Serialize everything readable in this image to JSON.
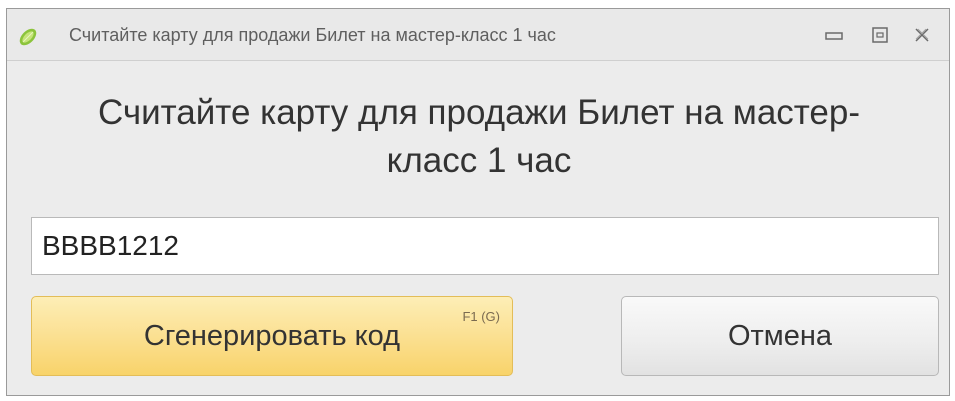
{
  "window": {
    "title": "Считайте карту для продажи Билет на мастер-класс 1 час",
    "icon": "lime-slice-icon"
  },
  "titlebar_buttons": {
    "minimize": "minimize-icon",
    "maximize": "maximize-icon",
    "close": "close-icon"
  },
  "prompt": {
    "line1": "Считайте карту для продажи Билет на мастер-",
    "line2": "класс 1 час"
  },
  "card_input": {
    "value": "BBBB1212",
    "placeholder": ""
  },
  "buttons": {
    "generate_label": "Сгенерировать код",
    "generate_hotkey": "F1 (G)",
    "cancel_label": "Отмена"
  },
  "colors": {
    "window_bg": "#ececec",
    "generate_button": "#fbe092",
    "cancel_button": "#ededed",
    "text": "#333333"
  }
}
